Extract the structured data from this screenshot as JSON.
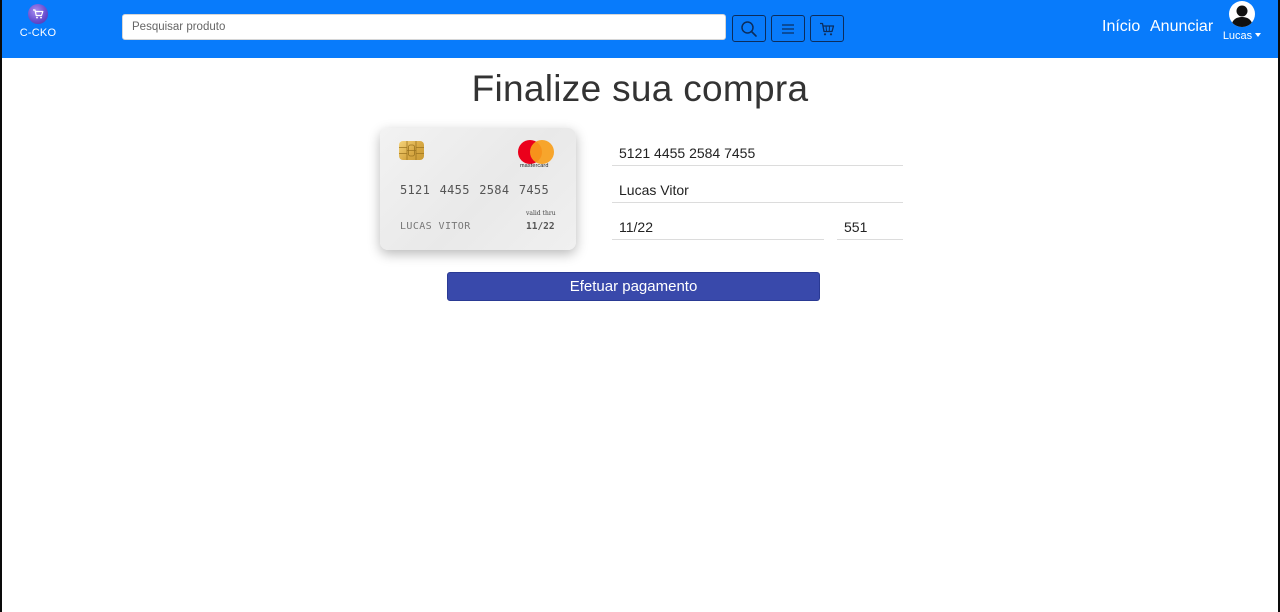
{
  "brand": {
    "name": "C-CKO",
    "logo_icon": "cart-icon"
  },
  "search": {
    "placeholder": "Pesquisar produto",
    "value": ""
  },
  "navbar": {
    "background": "#087bfb",
    "buttons": [
      {
        "icon": "search-icon"
      },
      {
        "icon": "menu-icon"
      },
      {
        "icon": "cart-icon"
      }
    ],
    "links": {
      "home": "Início",
      "advertise": "Anunciar"
    },
    "user": {
      "name": "Lucas",
      "icon": "user-avatar-icon"
    }
  },
  "page": {
    "title": "Finalize sua compra"
  },
  "card": {
    "number": "5121 4455 2584 7455",
    "holder": "LUCAS VITOR",
    "valid_label": "valid thru",
    "expiry": "11/22",
    "brand_text": "mastercard",
    "brand_colors": [
      "#eb001b",
      "#f79e1b"
    ]
  },
  "form": {
    "card_number": "5121 4455 2584 7455",
    "holder_name": "Lucas Vitor",
    "expiry": "11/22",
    "cvv": "551"
  },
  "pay_button": {
    "label": "Efetuar pagamento",
    "color": "#3949ab"
  }
}
